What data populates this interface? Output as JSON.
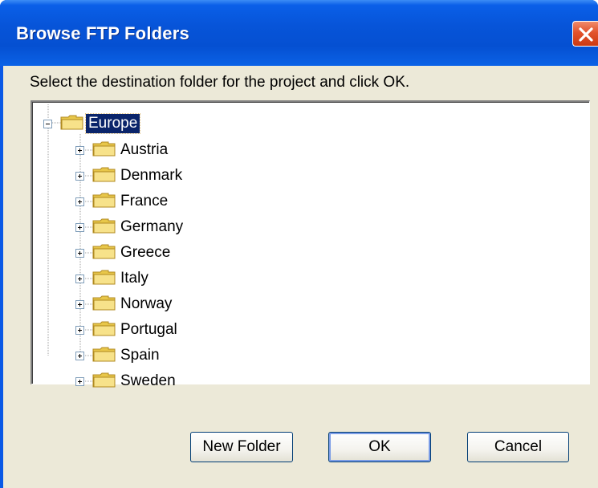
{
  "window": {
    "title": "Browse FTP Folders",
    "close_icon": "close-x-icon"
  },
  "instruction": "Select the destination folder for the project and click OK.",
  "tree": {
    "root": {
      "label": "Europe",
      "expanded": true,
      "selected": true,
      "icon": "folder-icon"
    },
    "children": [
      {
        "label": "Austria",
        "expanded": false,
        "icon": "folder-icon"
      },
      {
        "label": "Denmark",
        "expanded": false,
        "icon": "folder-icon"
      },
      {
        "label": "France",
        "expanded": false,
        "icon": "folder-icon"
      },
      {
        "label": "Germany",
        "expanded": false,
        "icon": "folder-icon"
      },
      {
        "label": "Greece",
        "expanded": false,
        "icon": "folder-icon"
      },
      {
        "label": "Italy",
        "expanded": false,
        "icon": "folder-icon"
      },
      {
        "label": "Norway",
        "expanded": false,
        "icon": "folder-icon"
      },
      {
        "label": "Portugal",
        "expanded": false,
        "icon": "folder-icon"
      },
      {
        "label": "Spain",
        "expanded": false,
        "icon": "folder-icon"
      },
      {
        "label": "Sweden",
        "expanded": false,
        "icon": "folder-icon"
      }
    ]
  },
  "buttons": {
    "new_folder": "New Folder",
    "ok": "OK",
    "cancel": "Cancel"
  },
  "colors": {
    "title_bar": "#0550d2",
    "dialog_face": "#ece9d8",
    "selection": "#0a246a",
    "close_button": "#e2522c"
  }
}
